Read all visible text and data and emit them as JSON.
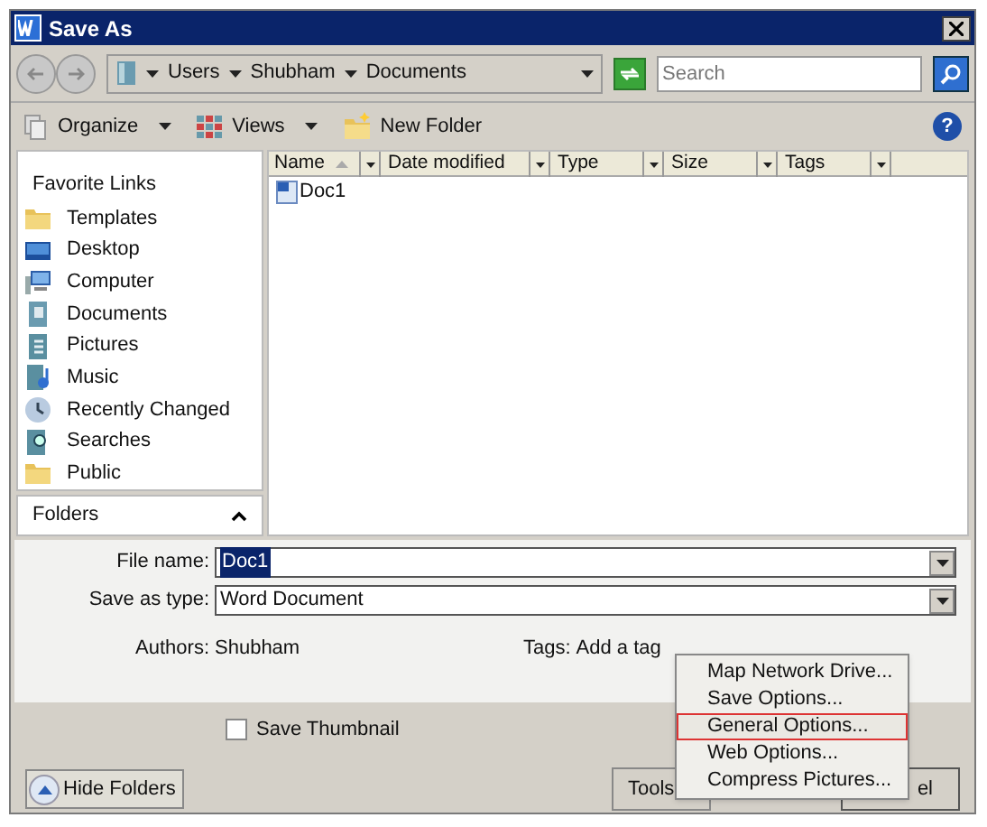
{
  "window": {
    "title": "Save As"
  },
  "address_bar": {
    "path": [
      "Users",
      "Shubham",
      "Documents"
    ]
  },
  "search": {
    "placeholder": "Search"
  },
  "toolbar": [
    {
      "label": "Organize",
      "kind": "menu"
    },
    {
      "label": "Views",
      "kind": "menu"
    },
    {
      "label": "New Folder",
      "kind": "button"
    }
  ],
  "favorite_links": {
    "title": "Favorite Links",
    "items": [
      "Templates",
      "Desktop",
      "Computer",
      "Documents",
      "Pictures",
      "Music",
      "Recently Changed",
      "Searches",
      "Public"
    ]
  },
  "folders": {
    "label": "Folders"
  },
  "file_list": {
    "columns": [
      {
        "label": "Name",
        "sorted": true
      },
      {
        "label": "Date modified",
        "sorted": false
      },
      {
        "label": "Type",
        "sorted": false
      },
      {
        "label": "Size",
        "sorted": false
      },
      {
        "label": "Tags",
        "sorted": false
      }
    ],
    "files": [
      "Doc1"
    ]
  },
  "form": {
    "file_name": {
      "label": "File name:",
      "value": "Doc1"
    },
    "save_as_type": {
      "label": "Save as type:",
      "value": "Word Document"
    },
    "authors": {
      "label": "Authors:",
      "value": "Shubham"
    },
    "tags": {
      "label": "Tags:",
      "placeholder": "Add a tag"
    }
  },
  "save_thumbnail": {
    "label": "Save Thumbnail",
    "checked": false
  },
  "hide_folders": "Hide Folders",
  "tools": "Tools",
  "help_button": "?",
  "cancel_button": "el",
  "tools_menu": [
    {
      "label": "Map Network Drive...",
      "selected": false
    },
    {
      "label": "Save Options...",
      "selected": false
    },
    {
      "label": "General Options...",
      "selected": true
    },
    {
      "label": "Web Options...",
      "selected": false
    },
    {
      "label": "Compress Pictures...",
      "selected": false
    }
  ]
}
